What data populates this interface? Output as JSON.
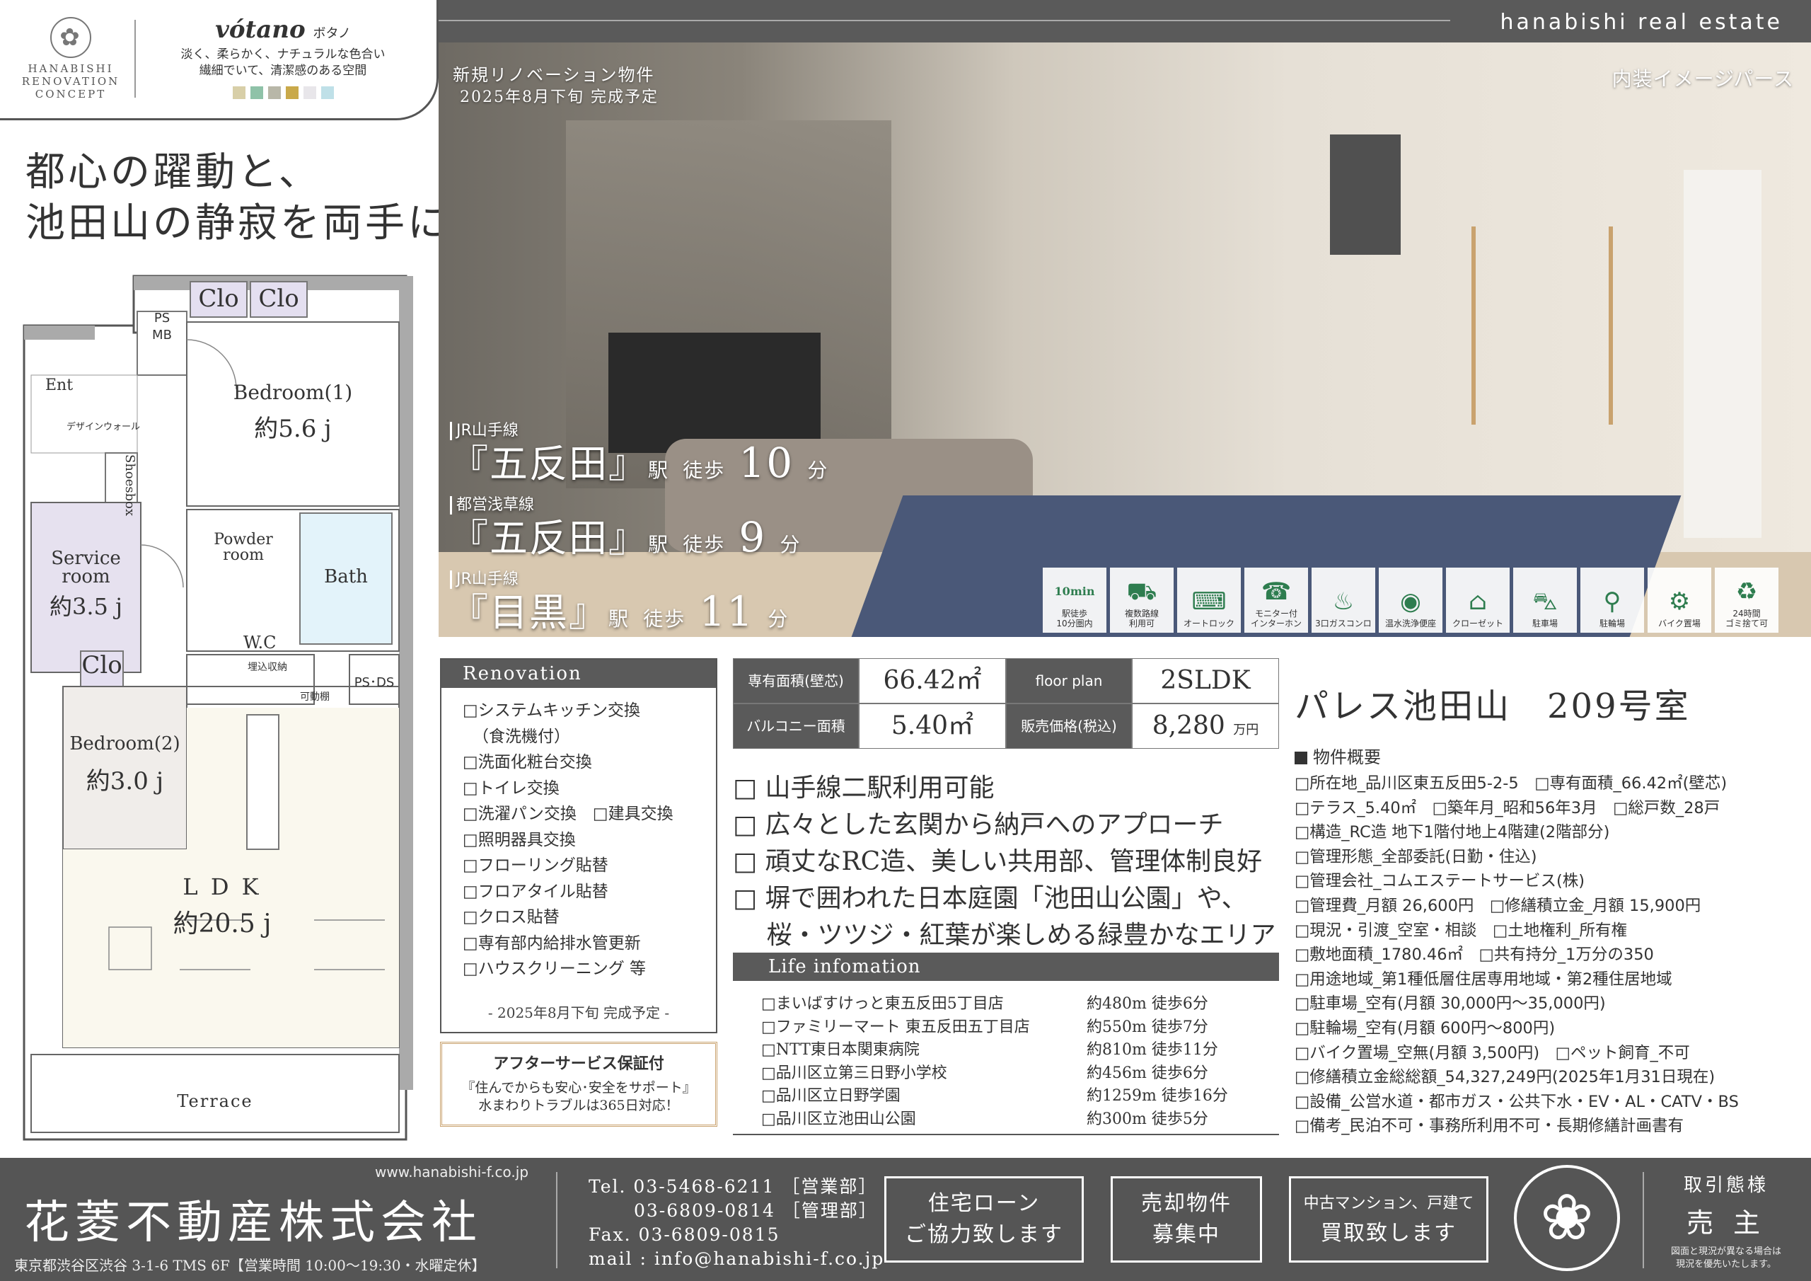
{
  "concept": {
    "logo_lines": [
      "HANABISHI",
      "RENOVATION",
      "CONCEPT"
    ],
    "name": "vótano",
    "name_kana": "ボタノ",
    "desc_line1": "淡く、柔らかく、ナチュラルな色合い",
    "desc_line2": "繊細でいて、清潔感のある空間",
    "swatch_colors": [
      "#d8cfa8",
      "#8fc2a8",
      "#b8b7a8",
      "#c9a94a",
      "#e8e6ea",
      "#bfe0e8"
    ]
  },
  "header": {
    "brand_en": "hanabishi real estate"
  },
  "headline": {
    "line1": "都心の躍動と、",
    "line2": "池田山の静寂を両手に。"
  },
  "hero": {
    "note_line1": "新規リノベーション物件",
    "note_line2": "2025年8月下旬 完成予定",
    "caption": "内装イメージパース",
    "stations": [
      {
        "line": "JR山手線",
        "name": "『五反田』",
        "eki": "駅",
        "walk": "徒歩",
        "minutes": "10",
        "unit": "分"
      },
      {
        "line": "都営浅草線",
        "name": "『五反田』",
        "eki": "駅",
        "walk": "徒歩",
        "minutes": "9",
        "unit": "分"
      },
      {
        "line": "JR山手線",
        "name": "『目黒』",
        "eki": "駅",
        "walk": "徒歩",
        "minutes": "11",
        "unit": "分"
      }
    ],
    "amenities": [
      {
        "label": "駅徒歩\n10分圏内",
        "icon": "walking-10min-icon",
        "glyph": "10min"
      },
      {
        "label": "複数路線\n利用可",
        "icon": "train-icon",
        "glyph": "⛟"
      },
      {
        "label": "オートロック",
        "icon": "autolock-icon",
        "glyph": "⌨"
      },
      {
        "label": "モニター付\nインターホン",
        "icon": "intercom-icon",
        "glyph": "☎"
      },
      {
        "label": "3口ガスコンロ",
        "icon": "gas-stove-icon",
        "glyph": "♨"
      },
      {
        "label": "温水洗浄便座",
        "icon": "toilet-icon",
        "glyph": "◉"
      },
      {
        "label": "クローゼット",
        "icon": "closet-icon",
        "glyph": "⌂"
      },
      {
        "label": "駐車場",
        "icon": "car-icon",
        "glyph": "⛍"
      },
      {
        "label": "駐輪場",
        "icon": "bicycle-icon",
        "glyph": "⚲"
      },
      {
        "label": "バイク置場",
        "icon": "motorbike-icon",
        "glyph": "⚙"
      },
      {
        "label": "24時間\nゴミ捨て可",
        "icon": "trash-24h-icon",
        "glyph": "♻"
      }
    ]
  },
  "floorplan": {
    "ps_mb": "PS\nMB",
    "clo1": "Clo",
    "clo2": "Clo",
    "ent": "Ent",
    "design_wall": "デザインウォール",
    "shoesbox": "Shoesbox",
    "bedroom1": "Bedroom(1)",
    "bedroom1_size": "約5.6 j",
    "powder": "Powder\nroom",
    "bath": "Bath",
    "service": "Service\nroom",
    "service_size": "約3.5 j",
    "wc": "W.C",
    "built_in": "埋込収納",
    "ps_ds": "PS･DS",
    "clo3": "Clo",
    "movable": "可動棚",
    "bedroom2": "Bedroom(2)",
    "bedroom2_size": "約3.0 j",
    "ldk": "L D K",
    "ldk_size": "約20.5 j",
    "terrace": "Terrace"
  },
  "renovation": {
    "title": "Renovation",
    "items": [
      "□システムキッチン交換",
      "（食洗機付）",
      "□洗面化粧台交換",
      "□トイレ交換",
      "□洗濯パン交換　□建具交換",
      "□照明器具交換",
      "□フローリング貼替",
      "□フロアタイル貼替",
      "□クロス貼替",
      "□専有部内給排水管更新",
      "□ハウスクリーニング 等"
    ],
    "footer": "- 2025年8月下旬 完成予定 -"
  },
  "after_service": {
    "title": "アフターサービス保証付",
    "line1": "『住んでからも安心･安全をサポート』",
    "line2": "水まわりトラブルは365日対応！"
  },
  "spec": {
    "area_label": "専有面積(壁芯)",
    "area_value": "66.42㎡",
    "plan_label": "floor plan",
    "plan_value": "2SLDK",
    "balcony_label": "バルコニー面積",
    "balcony_value": "5.40㎡",
    "price_label": "販売価格(税込)",
    "price_value": "8,280",
    "price_unit": "万円"
  },
  "features": [
    "□ 山手線二駅利用可能",
    "□ 広々とした玄関から納戸へのアプローチ",
    "□ 頑丈なRC造、美しい共用部、管理体制良好",
    "□ 塀で囲われた日本庭園「池田山公園」や、",
    "　 桜・ツツジ・紅葉が楽しめる緑豊かなエリア"
  ],
  "life": {
    "title": "Life infomation",
    "rows": [
      {
        "name": "□まいばすけっと東五反田5丁目店",
        "dist": "約480m 徒歩6分"
      },
      {
        "name": "□ファミリーマート 東五反田五丁目店",
        "dist": "約550m 徒歩7分"
      },
      {
        "name": "□NTT東日本関東病院",
        "dist": "約810m 徒歩11分"
      },
      {
        "name": "□品川区立第三日野小学校",
        "dist": "約456m 徒歩6分"
      },
      {
        "name": "□品川区立日野学園",
        "dist": "約1259m 徒歩16分"
      },
      {
        "name": "□品川区立池田山公園",
        "dist": "約300m 徒歩5分"
      }
    ]
  },
  "property": {
    "title": "パレス池田山　209号室",
    "overview_heading": "物件概要",
    "details": [
      "□所在地_品川区東五反田5-2-5　□専有面積_66.42㎡(壁芯)",
      "□テラス_5.40㎡　□築年月_昭和56年3月　□総戸数_28戸",
      "□構造_RC造 地下1階付地上4階建(2階部分)",
      "□管理形態_全部委託(日勤・住込)",
      "□管理会社_コムエステートサービス(株)",
      "□管理費_月額 26,600円　□修繕積立金_月額 15,900円",
      "□現況・引渡_空室・相談　□土地権利_所有権",
      "□敷地面積_1780.46㎡　□共有持分_1万分の350",
      "□用途地域_第1種低層住居専用地域・第2種住居地域",
      "□駐車場_空有(月額 30,000円〜35,000円)",
      "□駐輪場_空有(月額 600円〜800円)",
      "□バイク置場_空無(月額 3,500円)　□ペット飼育_不可",
      "□修繕積立金総総額_54,327,249円(2025年1月31日現在)",
      "□設備_公営水道・都市ガス・公共下水・EV・AL・CATV・BS",
      "□備考_民泊不可・事務所利用不可・長期修繕計画書有"
    ]
  },
  "footer": {
    "url": "www.hanabishi-f.co.jp",
    "company": "花菱不動産株式会社",
    "address": "東京都渋谷区渋谷 3-1-6 TMS 6F【営業時間 10:00〜19:30・水曜定休】",
    "tel_line1": "Tel. 03-5468-6211 ［営業部］",
    "tel_line2": "　　 03-6809-0814 ［管理部］",
    "fax": "Fax. 03-6809-0815",
    "mail": "mail : info@hanabishi-f.co.jp",
    "box1_line1": "住宅ローン",
    "box1_line2": "ご協力致します",
    "box2_line1": "売却物件",
    "box2_line2": "募集中",
    "box3_line1": "中古マンション、戸建て",
    "box3_line2": "買取致します",
    "torihiki_label": "取引態様",
    "torihiki_value": "売 主",
    "disclaimer": "図面と現況が異なる場合は\n現況を優先いたします。"
  }
}
